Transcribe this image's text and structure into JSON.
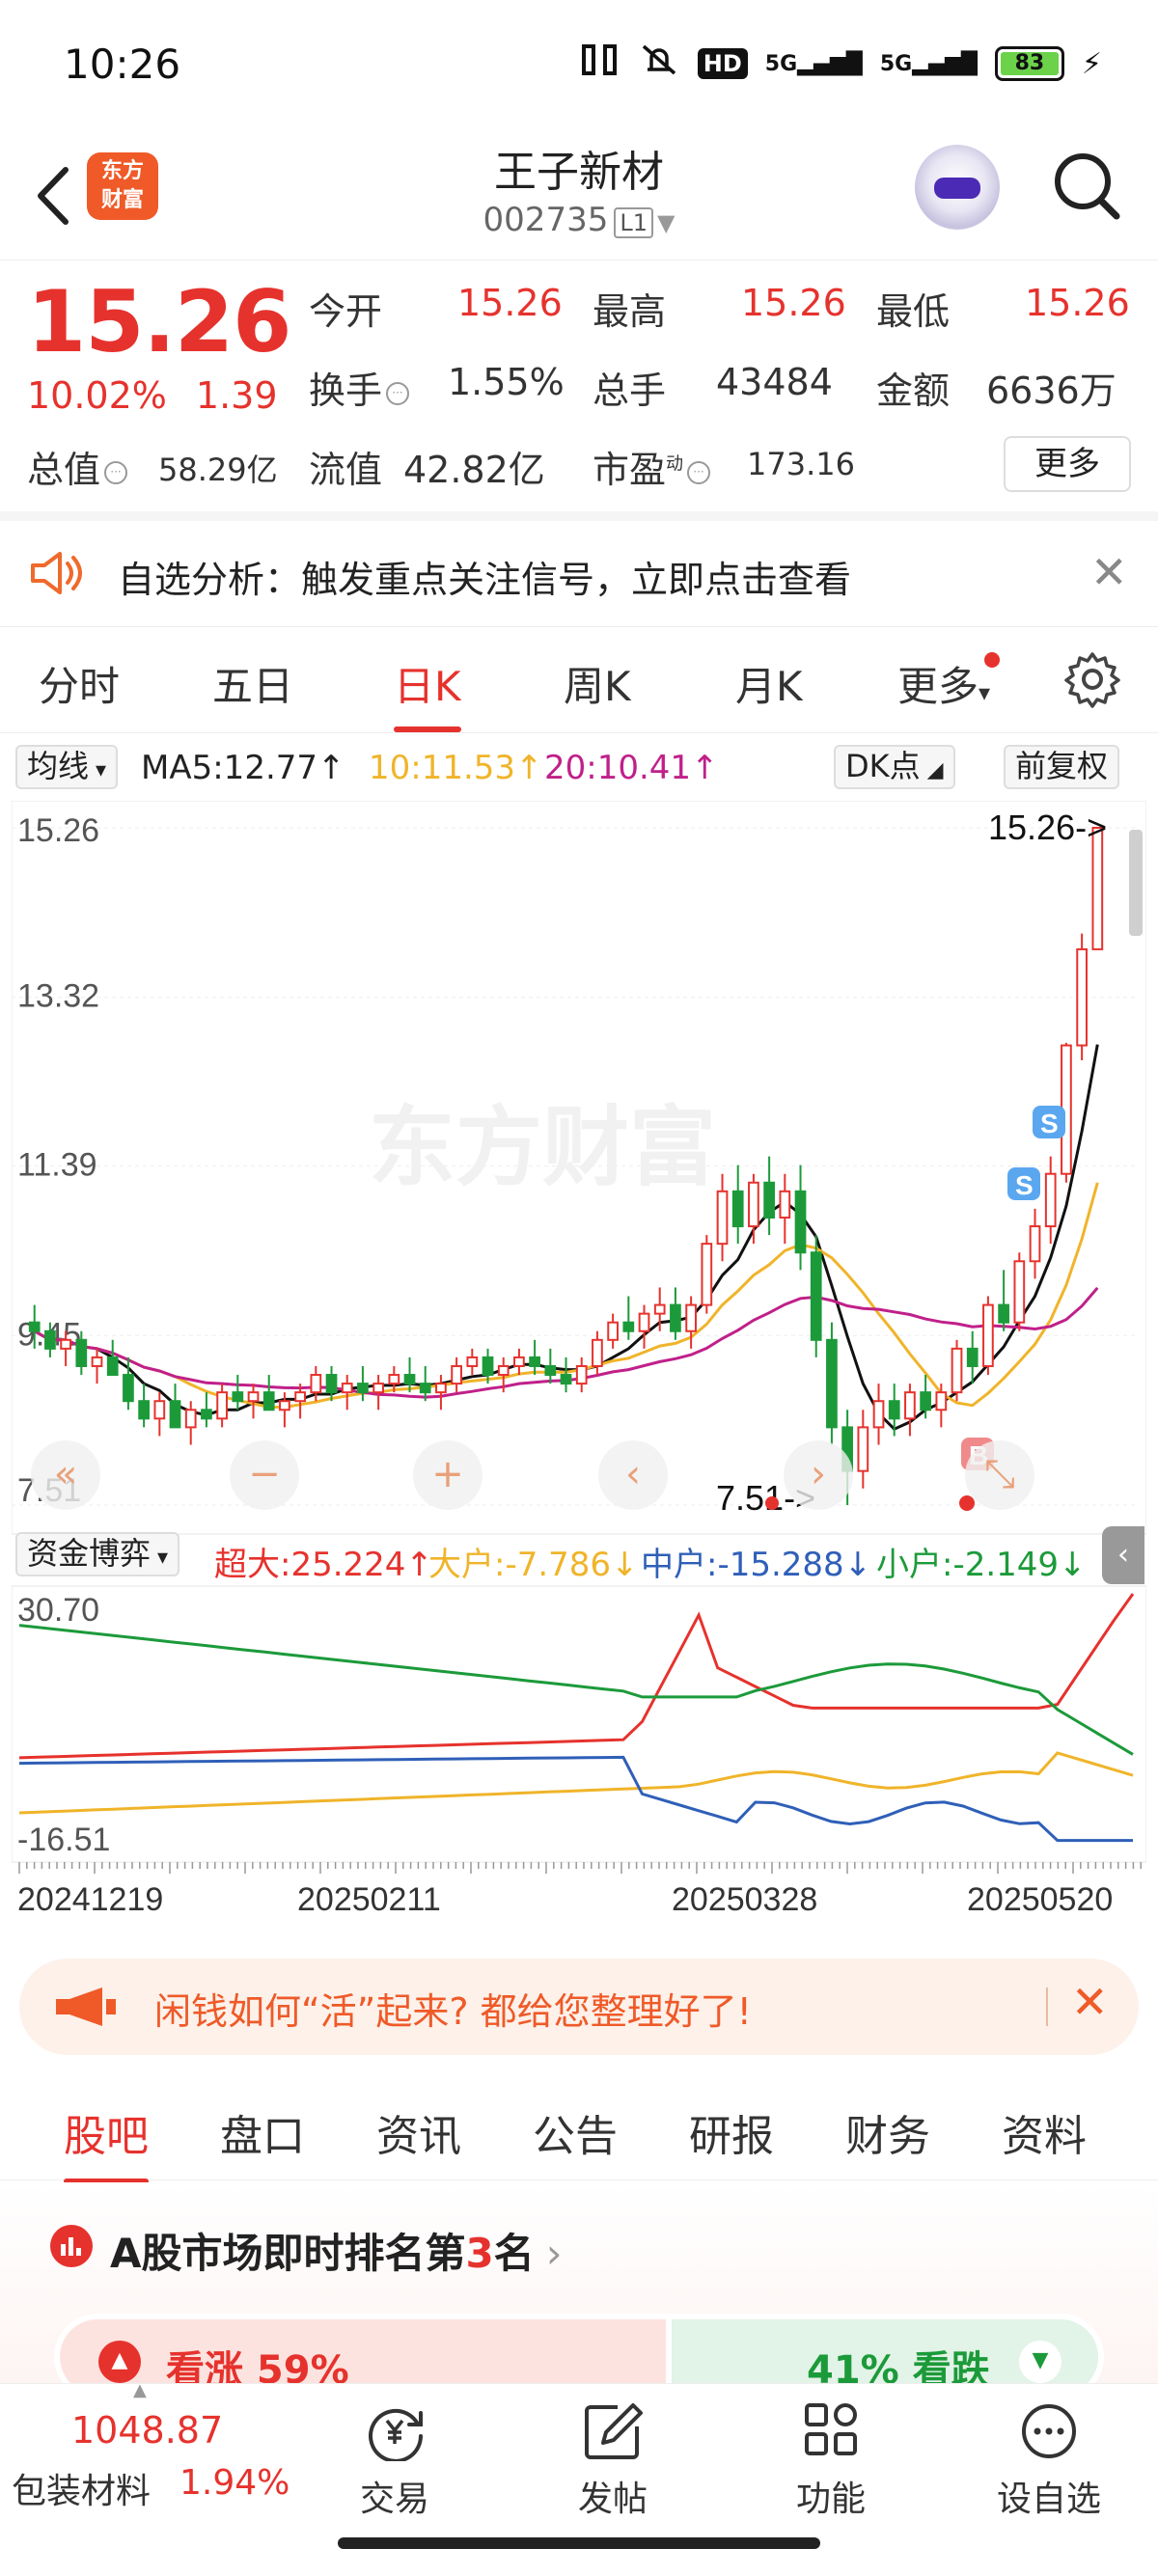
{
  "status": {
    "time": "10:26",
    "hd": "HD",
    "net1": "5G",
    "net2": "5G",
    "battery": "83"
  },
  "header": {
    "logo": "东方财富",
    "title": "王子新材",
    "code": "002735",
    "level": "L1"
  },
  "quote": {
    "price": "15.26",
    "pct": "10.02%",
    "change": "1.39",
    "open_label": "今开",
    "open": "15.26",
    "high_label": "最高",
    "high": "15.26",
    "low_label": "最低",
    "low": "15.26",
    "turnover_label": "换手",
    "turnover": "1.55%",
    "volume_label": "总手",
    "volume": "43484",
    "amount_label": "金额",
    "amount": "6636万",
    "mcap_label": "总值",
    "mcap": "58.29亿",
    "float_label": "流值",
    "float": "42.82亿",
    "pe_label": "市盈",
    "pe_sup": "动",
    "pe": "173.16",
    "more": "更多"
  },
  "alert": {
    "text": "自选分析：触发重点关注信号，立即点击查看"
  },
  "tabs": [
    "分时",
    "五日",
    "日K",
    "周K",
    "月K",
    "更多"
  ],
  "ma": {
    "selector": "均线",
    "ma5": "MA5:12.77",
    "ma10": "10:11.53",
    "ma20": "20:10.41",
    "dk": "DK点",
    "adjust": "前复权"
  },
  "kline": {
    "price_labels": [
      "15.26",
      "13.32",
      "11.39",
      "9.45",
      "7.51"
    ],
    "max_marker": "15.26->",
    "min_marker": "7.51->",
    "signal_s": "S",
    "signal_b": "B"
  },
  "funds": {
    "selector": "资金博弈",
    "super": "超大:25.224",
    "big": "大户:-7.786",
    "mid": "中户:-15.288",
    "small": "小户:-2.149",
    "top": "30.70",
    "bottom": "-16.51"
  },
  "dates": [
    "20241219",
    "20250211",
    "20250328",
    "20250520"
  ],
  "banner": {
    "text": "闲钱如何“活”起来? 都给您整理好了!"
  },
  "bottom_tabs": [
    "股吧",
    "盘口",
    "资讯",
    "公告",
    "研报",
    "财务",
    "资料"
  ],
  "rank": {
    "title_pre": "A股市场即时排名第",
    "num": "3",
    "title_post": "名",
    "up": "看涨 59%",
    "down": "41% 看跌"
  },
  "nav": {
    "index_value": "1048.87",
    "index_name": "包装材料",
    "index_pct": "1.94%",
    "items": [
      "交易",
      "发帖",
      "功能",
      "设自选"
    ]
  },
  "colors": {
    "red": "#e6322d",
    "green": "#1c9a3a",
    "ma10": "#f0b42a",
    "ma20": "#c0208a",
    "blue": "#2f5fb8"
  },
  "chart_data": {
    "type": "candlestick",
    "title": "",
    "ylim": [
      7.51,
      15.26
    ],
    "x_labels": [
      "20241219",
      "20250211",
      "20250328",
      "20250520"
    ],
    "candles": [
      [
        9.6,
        9.8,
        9.3,
        9.5
      ],
      [
        9.5,
        9.6,
        9.2,
        9.3
      ],
      [
        9.3,
        9.5,
        9.1,
        9.4
      ],
      [
        9.4,
        9.5,
        9.0,
        9.1
      ],
      [
        9.1,
        9.3,
        8.9,
        9.2
      ],
      [
        9.2,
        9.4,
        9.0,
        9.0
      ],
      [
        9.0,
        9.2,
        8.6,
        8.7
      ],
      [
        8.7,
        8.9,
        8.4,
        8.5
      ],
      [
        8.5,
        8.8,
        8.3,
        8.7
      ],
      [
        8.7,
        8.9,
        8.4,
        8.4
      ],
      [
        8.4,
        8.7,
        8.2,
        8.6
      ],
      [
        8.6,
        8.8,
        8.4,
        8.5
      ],
      [
        8.5,
        8.9,
        8.4,
        8.8
      ],
      [
        8.8,
        9.0,
        8.6,
        8.7
      ],
      [
        8.7,
        8.9,
        8.5,
        8.8
      ],
      [
        8.8,
        9.0,
        8.6,
        8.6
      ],
      [
        8.6,
        8.8,
        8.4,
        8.7
      ],
      [
        8.7,
        8.9,
        8.5,
        8.8
      ],
      [
        8.8,
        9.1,
        8.7,
        9.0
      ],
      [
        9.0,
        9.1,
        8.7,
        8.8
      ],
      [
        8.8,
        9.0,
        8.6,
        8.9
      ],
      [
        8.9,
        9.1,
        8.7,
        8.8
      ],
      [
        8.8,
        9.0,
        8.6,
        8.9
      ],
      [
        8.9,
        9.1,
        8.8,
        9.0
      ],
      [
        9.0,
        9.2,
        8.8,
        8.9
      ],
      [
        8.9,
        9.1,
        8.7,
        8.8
      ],
      [
        8.8,
        9.0,
        8.6,
        8.9
      ],
      [
        8.9,
        9.2,
        8.8,
        9.1
      ],
      [
        9.1,
        9.3,
        9.0,
        9.2
      ],
      [
        9.2,
        9.3,
        8.9,
        9.0
      ],
      [
        9.0,
        9.2,
        8.8,
        9.1
      ],
      [
        9.1,
        9.3,
        9.0,
        9.2
      ],
      [
        9.2,
        9.4,
        9.0,
        9.1
      ],
      [
        9.1,
        9.3,
        8.9,
        9.0
      ],
      [
        9.0,
        9.2,
        8.8,
        8.9
      ],
      [
        8.9,
        9.2,
        8.8,
        9.1
      ],
      [
        9.1,
        9.5,
        9.0,
        9.4
      ],
      [
        9.4,
        9.7,
        9.3,
        9.6
      ],
      [
        9.6,
        9.9,
        9.4,
        9.5
      ],
      [
        9.5,
        9.8,
        9.3,
        9.7
      ],
      [
        9.7,
        10.0,
        9.5,
        9.8
      ],
      [
        9.8,
        10.0,
        9.4,
        9.5
      ],
      [
        9.5,
        9.9,
        9.3,
        9.8
      ],
      [
        9.8,
        10.6,
        9.7,
        10.5
      ],
      [
        10.5,
        11.3,
        10.3,
        11.1
      ],
      [
        11.1,
        11.4,
        10.5,
        10.7
      ],
      [
        10.7,
        11.3,
        10.5,
        11.2
      ],
      [
        11.2,
        11.5,
        10.6,
        10.8
      ],
      [
        10.8,
        11.3,
        10.5,
        11.1
      ],
      [
        11.1,
        11.4,
        10.2,
        10.4
      ],
      [
        10.4,
        10.6,
        9.2,
        9.4
      ],
      [
        9.4,
        9.6,
        8.2,
        8.4
      ],
      [
        8.4,
        8.6,
        7.51,
        7.9
      ],
      [
        7.9,
        8.6,
        7.7,
        8.4
      ],
      [
        8.4,
        8.9,
        8.2,
        8.7
      ],
      [
        8.7,
        8.9,
        8.3,
        8.5
      ],
      [
        8.5,
        8.9,
        8.3,
        8.8
      ],
      [
        8.8,
        9.0,
        8.5,
        8.6
      ],
      [
        8.6,
        8.9,
        8.4,
        8.8
      ],
      [
        8.8,
        9.4,
        8.7,
        9.3
      ],
      [
        9.3,
        9.5,
        8.9,
        9.1
      ],
      [
        9.1,
        9.9,
        9.0,
        9.8
      ],
      [
        9.8,
        10.2,
        9.5,
        9.6
      ],
      [
        9.6,
        10.4,
        9.5,
        10.3
      ],
      [
        10.3,
        10.9,
        10.1,
        10.7
      ],
      [
        10.7,
        11.5,
        10.5,
        11.3
      ],
      [
        11.3,
        12.8,
        11.2,
        12.77
      ],
      [
        12.77,
        14.05,
        12.6,
        13.87
      ],
      [
        13.87,
        15.26,
        13.87,
        15.26
      ]
    ]
  }
}
